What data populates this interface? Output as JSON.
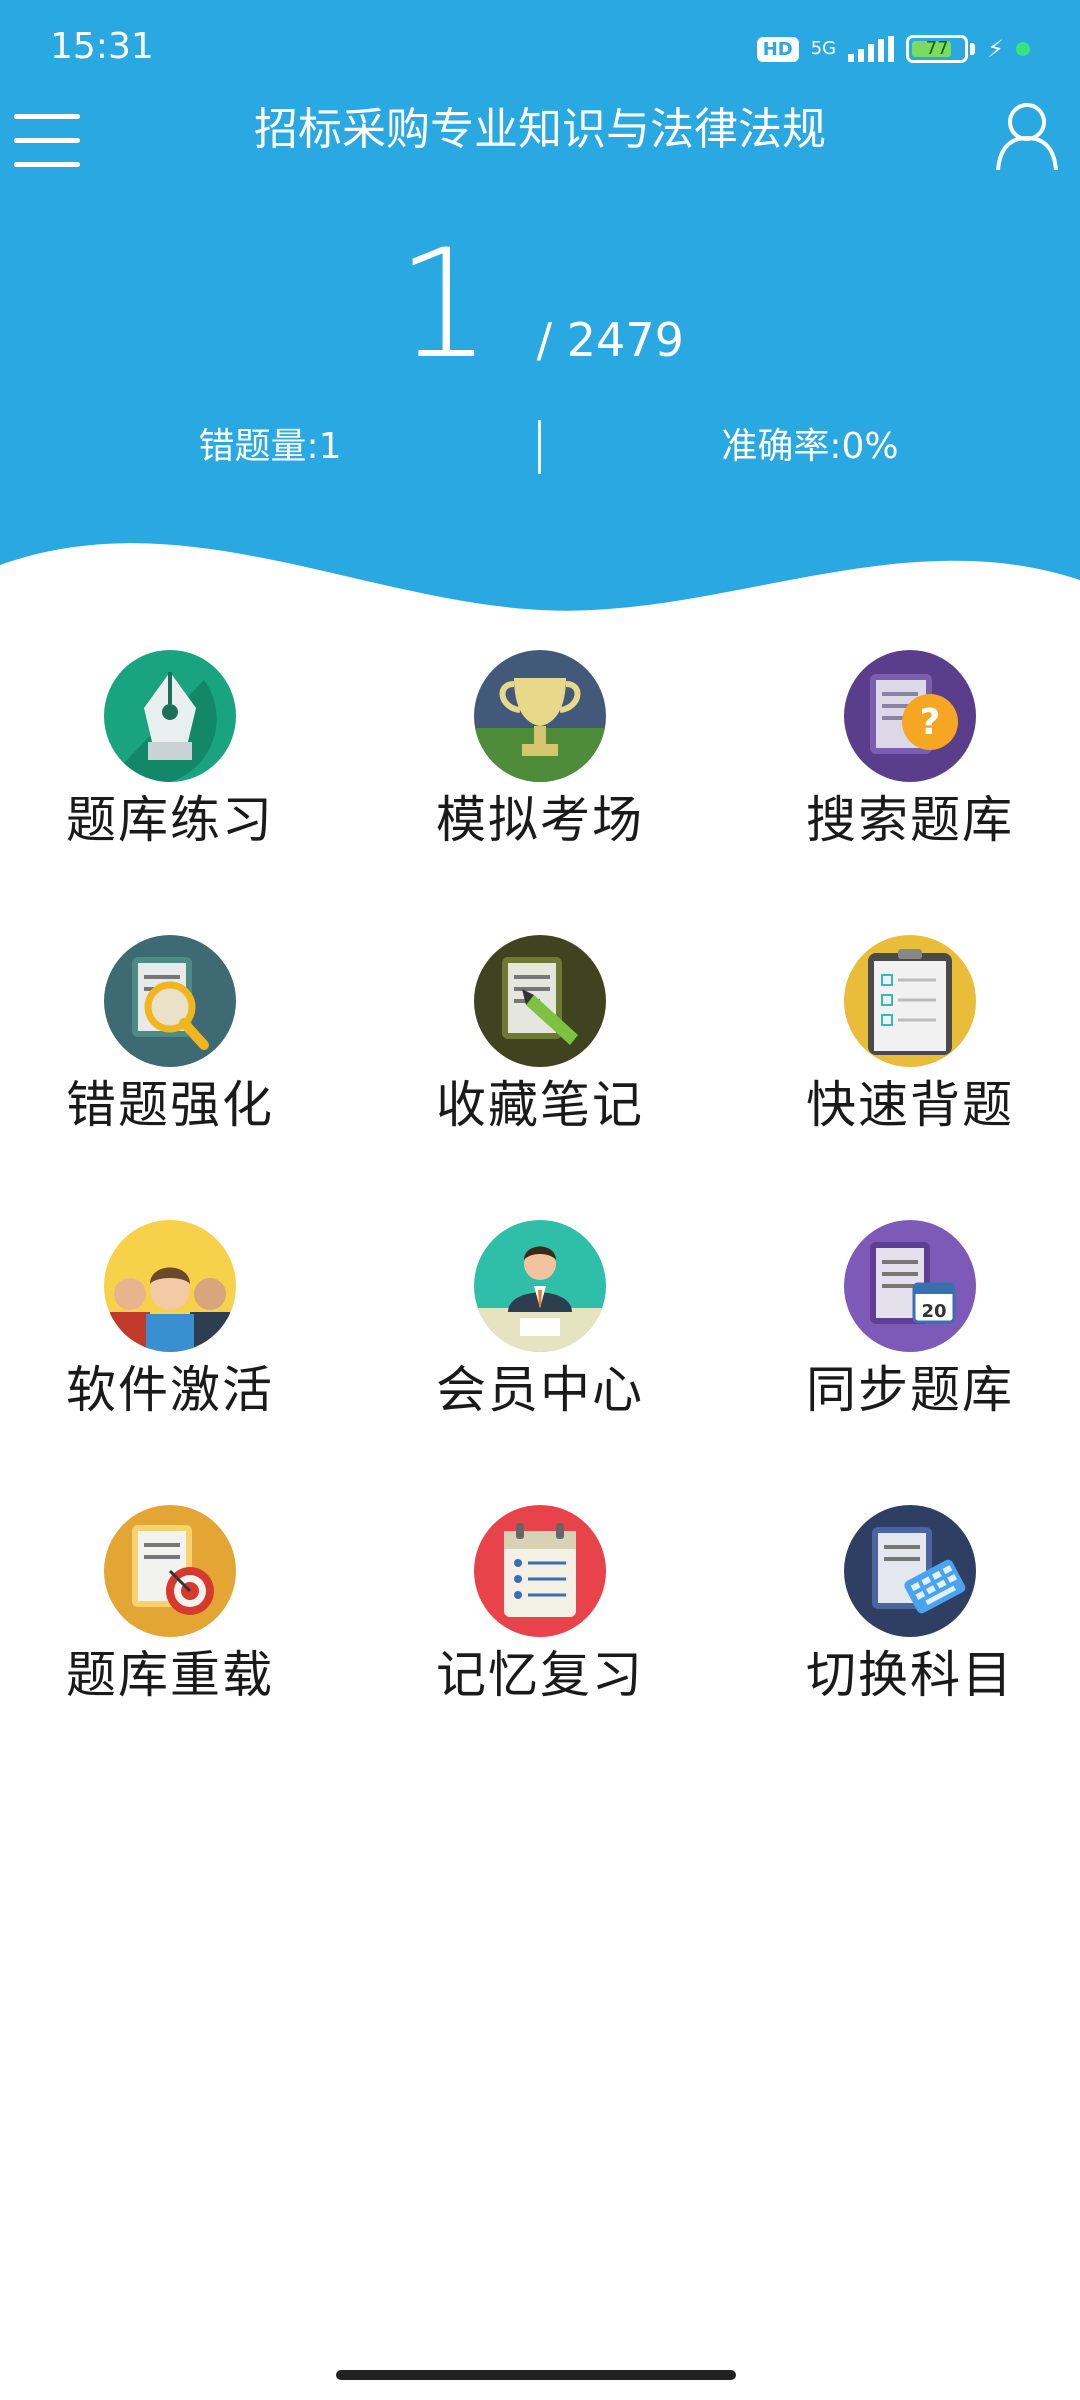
{
  "status_bar": {
    "time": "15:31",
    "hd": "HD",
    "network": "5G",
    "battery": "77",
    "battery_level": 0.77
  },
  "header": {
    "title": "招标采购专业知识与法律法规",
    "menu_icon": "menu-icon",
    "user_icon": "user-icon",
    "accent_color": "#2aa8e2"
  },
  "progress": {
    "current": "1",
    "total": "/ 2479"
  },
  "stats": {
    "wrong_count": "错题量:1",
    "accuracy": "准确率:0%"
  },
  "menu": [
    {
      "label": "题库练习",
      "icon": "pen-nib-icon"
    },
    {
      "label": "模拟考场",
      "icon": "trophy-icon"
    },
    {
      "label": "搜索题库",
      "icon": "question-document-icon"
    },
    {
      "label": "错题强化",
      "icon": "magnifier-document-icon"
    },
    {
      "label": "收藏笔记",
      "icon": "pencil-document-icon"
    },
    {
      "label": "快速背题",
      "icon": "clipboard-checklist-icon"
    },
    {
      "label": "软件激活",
      "icon": "group-people-icon"
    },
    {
      "label": "会员中心",
      "icon": "member-person-icon"
    },
    {
      "label": "同步题库",
      "icon": "calendar-document-icon"
    },
    {
      "label": "题库重载",
      "icon": "target-document-icon"
    },
    {
      "label": "记忆复习",
      "icon": "calendar-list-icon"
    },
    {
      "label": "切换科目",
      "icon": "keyboard-document-icon"
    }
  ]
}
